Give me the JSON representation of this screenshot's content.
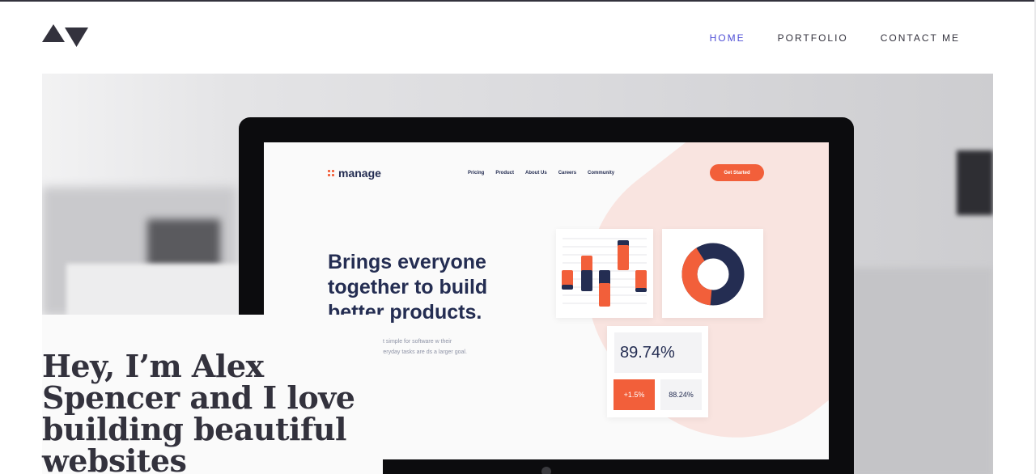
{
  "nav": {
    "items": [
      {
        "label": "HOME",
        "active": true
      },
      {
        "label": "PORTFOLIO",
        "active": false
      },
      {
        "label": "CONTACT ME",
        "active": false
      }
    ]
  },
  "hero": {
    "mockup": {
      "logo_text": "manage",
      "nav_items": [
        "Pricing",
        "Product",
        "About Us",
        "Careers",
        "Community"
      ],
      "cta_label": "Get Started",
      "headline": "Brings everyone together to build better products.",
      "subtext": "s it simple for software w their everyday tasks are ds a larger goal.",
      "stat_main": "89.74%",
      "stat_change": "+1.5%",
      "stat_secondary": "88.24%"
    }
  },
  "intro": {
    "heading": "Hey, I’m Alex Spencer and I love building beautiful websites"
  },
  "colors": {
    "accent": "#4f4fd6",
    "dark": "#33323d",
    "mockup_orange": "#f25f3a",
    "mockup_navy": "#242d52"
  }
}
